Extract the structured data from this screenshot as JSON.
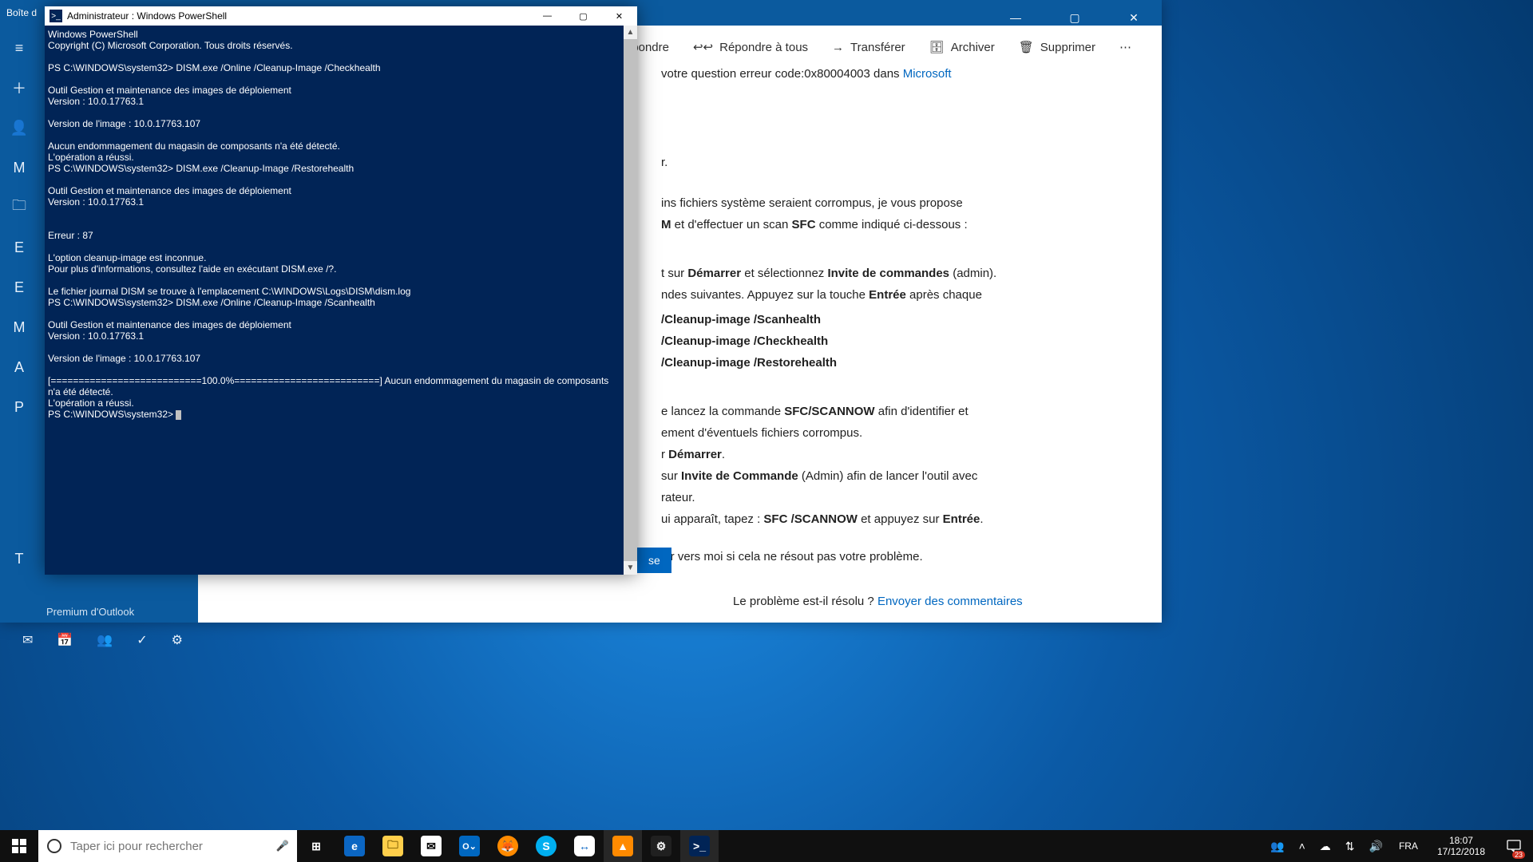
{
  "mail": {
    "title_prefix": "Boîte d",
    "win_min": "—",
    "win_max": "▢",
    "win_close": "✕",
    "rail": {
      "menu": "≡",
      "compose": "＋",
      "account": "👤",
      "folder": "🗀",
      "letter_e1": "E",
      "letter_e2": "E",
      "letter_m": "M",
      "letter_a": "A",
      "letter_p": "P",
      "letter_t": "T"
    },
    "mid": {
      "premium": "Premium d'Outlook"
    },
    "footer": {
      "mail": "✉",
      "cal": "📅",
      "people": "👥",
      "todo": "✓",
      "settings": "⚙"
    },
    "toolbar": {
      "reply": "Répondre",
      "reply_all": "Répondre à tous",
      "forward": "Transférer",
      "archive": "Archiver",
      "delete": "Supprimer",
      "more": "⋯",
      "reply_ic": "↩",
      "reply_all_ic": "↩↩",
      "forward_ic": "→",
      "archive_ic": "🗄",
      "delete_ic": "🗑"
    },
    "content": {
      "question_line_1": " votre question erreur code:0x80004003 dans ",
      "question_link": "Microsoft",
      "p1_tail": "r.",
      "p2a": "ins fichiers système seraient corrompus, je vous propose",
      "p2b_1": "M",
      "p2b_2": " et d'effectuer un scan ",
      "p2b_3": "SFC",
      "p2b_4": " comme indiqué ci-dessous :",
      "p3a_1": "t sur ",
      "p3a_2": "Démarrer",
      "p3a_3": " et sélectionnez ",
      "p3a_4": "Invite de commandes",
      "p3a_5": " (admin).",
      "p3b_1": "ndes suivantes. Appuyez sur la touche ",
      "p3b_2": "Entrée",
      "p3b_3": " après chaque",
      "cmd1": "/Cleanup-image /Scanhealth",
      "cmd2": "/Cleanup-image /Checkhealth",
      "cmd3": "/Cleanup-image /Restorehealth",
      "s1a": "e lancez la commande ",
      "s1b": "SFC/SCANNOW",
      "s1c": " afin d'identifier et",
      "s2": "ement d'éventuels fichiers corrompus.",
      "s3a": "r ",
      "s3b": "Démarrer",
      "s3c": ".",
      "s4a": " sur ",
      "s4b": "Invite de Commande",
      "s4c": " (Admin) afin de lancer l'outil avec",
      "s5": "rateur.",
      "s6a": "ui apparaît, tapez : ",
      "s6b": "SFC /SCANNOW",
      "s6c": " et appuyez sur ",
      "s6d": "Entrée",
      "s6e": ".",
      "p_end": "nir vers moi si cela ne résout pas votre problème.",
      "bluebtn_tail": "se",
      "resolved_q": "Le problème est-il résolu ? ",
      "resolved_link": "Envoyer des commentaires"
    }
  },
  "ps": {
    "title": "Administrateur : Windows PowerShell",
    "icon_glyph": ">_",
    "win_min": "—",
    "win_max": "▢",
    "win_close": "✕",
    "scroll_up": "▲",
    "scroll_down": "▼",
    "lines": "Windows PowerShell\nCopyright (C) Microsoft Corporation. Tous droits réservés.\n\nPS C:\\WINDOWS\\system32> DISM.exe /Online /Cleanup-Image /Checkhealth\n\nOutil Gestion et maintenance des images de déploiement\nVersion : 10.0.17763.1\n\nVersion de l'image : 10.0.17763.107\n\nAucun endommagement du magasin de composants n'a été détecté.\nL'opération a réussi.\nPS C:\\WINDOWS\\system32> DISM.exe /Cleanup-Image /Restorehealth\n\nOutil Gestion et maintenance des images de déploiement\nVersion : 10.0.17763.1\n\n\nErreur : 87\n\nL'option cleanup-image est inconnue.\nPour plus d'informations, consultez l'aide en exécutant DISM.exe /?.\n\nLe fichier journal DISM se trouve à l'emplacement C:\\WINDOWS\\Logs\\DISM\\dism.log\nPS C:\\WINDOWS\\system32> DISM.exe /Online /Cleanup-Image /Scanhealth\n\nOutil Gestion et maintenance des images de déploiement\nVersion : 10.0.17763.1\n\nVersion de l'image : 10.0.17763.107\n\n[===========================100.0%==========================] Aucun endommagement du magasin de composants n'a été détecté.\nL'opération a réussi.\nPS C:\\WINDOWS\\system32> "
  },
  "taskbar": {
    "search_placeholder": "Taper ici pour rechercher",
    "mic": "🎤",
    "lang": "FRA",
    "time": "18:07",
    "date": "17/12/2018",
    "notif_count": "23",
    "tray": {
      "people": "👥",
      "up": "˄",
      "cloud": "☁",
      "net": "⇅",
      "vol": "🔊"
    },
    "apps": {
      "taskview": "⊞",
      "edge": "e",
      "explorer": "🗀",
      "mail": "✉",
      "outlook": "O⌄",
      "firefox": "🦊",
      "skype": "S",
      "tv": "↔",
      "vlc": "▲",
      "gear": "⚙",
      "ps": ">_"
    }
  }
}
